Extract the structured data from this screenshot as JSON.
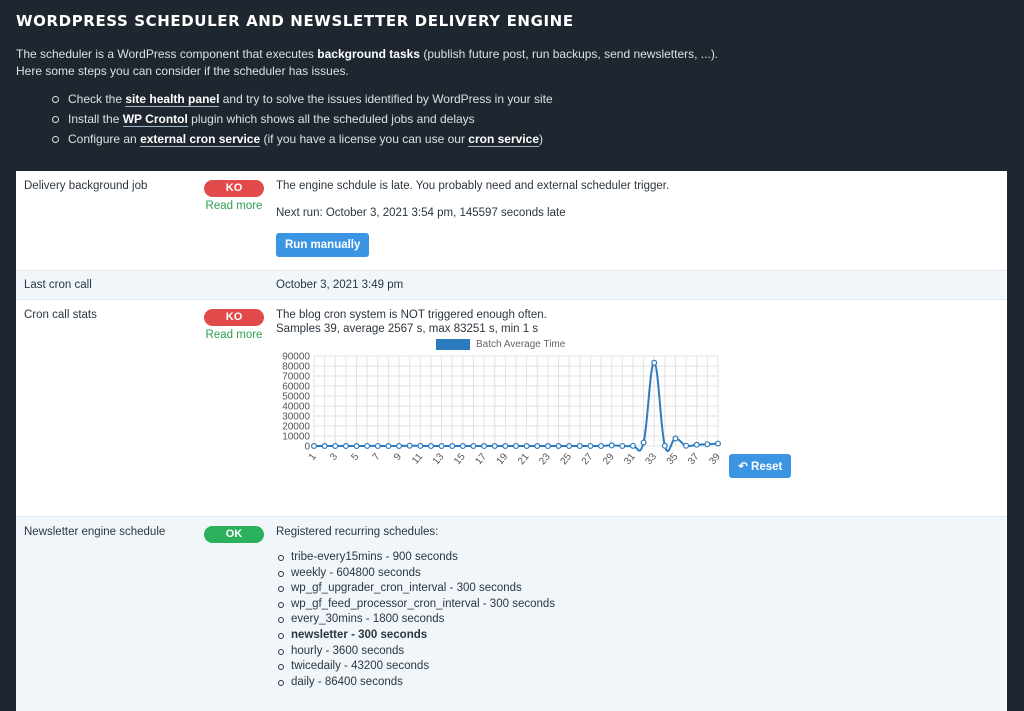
{
  "header": {
    "title": "WORDPRESS SCHEDULER AND NEWSLETTER DELIVERY ENGINE",
    "intro_p1": "The scheduler is a WordPress component that executes",
    "intro_bold": "background tasks",
    "intro_p2": "(publish future post, run backups, send newsletters, ...).",
    "intro_line2": "Here some steps you can consider if the scheduler has issues.",
    "steps": [
      {
        "pre": "Check the",
        "link": "site health panel",
        "post": "and try to solve the issues identified by WordPress in your site"
      },
      {
        "pre": "Install the",
        "link": "WP Crontol",
        "post": "plugin which shows all the scheduled jobs and delays"
      },
      {
        "pre": "Configure an",
        "link": "external cron service",
        "mid": "(if you have a license you can use our",
        "link2": "cron service",
        "post": ")"
      }
    ]
  },
  "rows": {
    "delivery": {
      "label": "Delivery background job",
      "badge": "KO",
      "read_more": "Read more",
      "message": "The engine schdule is late. You probably need and external scheduler trigger.",
      "next_run": "Next run: October 3, 2021 3:54 pm, 145597 seconds late",
      "button": "Run manually"
    },
    "last_cron": {
      "label": "Last cron call",
      "value": "October 3, 2021 3:49 pm"
    },
    "stats": {
      "label": "Cron call stats",
      "badge": "KO",
      "read_more": "Read more",
      "message": "The blog cron system is NOT triggered enough often.",
      "samples": "Samples 39, average 2567 s, max 83251 s, min 1 s",
      "reset": "Reset"
    },
    "schedule": {
      "label": "Newsletter engine schedule",
      "badge": "OK",
      "heading": "Registered recurring schedules:",
      "items": [
        "tribe-every15mins - 900 seconds",
        "weekly - 604800 seconds",
        "wp_gf_upgrader_cron_interval - 300 seconds",
        "wp_gf_feed_processor_cron_interval - 300 seconds",
        "every_30mins - 1800 seconds",
        "newsletter - 300 seconds",
        "hourly - 3600 seconds",
        "twicedaily - 43200 seconds",
        "daily - 86400 seconds"
      ],
      "bold_index": 5
    }
  },
  "colors": {
    "ko": "#e14b4b",
    "ok": "#2bb15c",
    "button": "#3b95e2",
    "series": "#2d7bbf"
  },
  "chart_data": {
    "type": "line",
    "series": [
      {
        "name": "Batch Average Time",
        "values": [
          1,
          5,
          3,
          2,
          4,
          60,
          50,
          2,
          1,
          300,
          120,
          4,
          6,
          9,
          3,
          10,
          5,
          2,
          8,
          40,
          3,
          6,
          2,
          11,
          7,
          14,
          20,
          30,
          600,
          25,
          150,
          3500,
          83251,
          200,
          7500,
          300,
          1200,
          1800,
          2400
        ]
      }
    ],
    "x": [
      1,
      2,
      3,
      4,
      5,
      6,
      7,
      8,
      9,
      10,
      11,
      12,
      13,
      14,
      15,
      16,
      17,
      18,
      19,
      20,
      21,
      22,
      23,
      24,
      25,
      26,
      27,
      28,
      29,
      30,
      31,
      32,
      33,
      34,
      35,
      36,
      37,
      38,
      39
    ],
    "x_tick_labels": [
      "1",
      "3",
      "5",
      "7",
      "9",
      "11",
      "13",
      "15",
      "17",
      "19",
      "21",
      "23",
      "25",
      "27",
      "29",
      "31",
      "33",
      "35",
      "37",
      "39"
    ],
    "y_tick_labels": [
      "0",
      "10000",
      "20000",
      "30000",
      "40000",
      "50000",
      "60000",
      "70000",
      "80000",
      "90000"
    ],
    "ylim": [
      0,
      90000
    ],
    "grid": true,
    "legend": "top"
  }
}
